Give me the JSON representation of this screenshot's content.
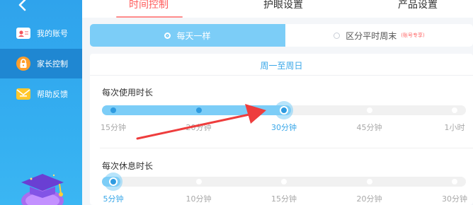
{
  "sidebar": {
    "items": [
      {
        "label": "我的账号",
        "icon": "id-card-icon",
        "active": false
      },
      {
        "label": "家长控制",
        "icon": "lock-icon",
        "active": true
      },
      {
        "label": "帮助反馈",
        "icon": "message-icon",
        "active": false
      }
    ]
  },
  "tabs": [
    {
      "label": "时间控制",
      "active": true
    },
    {
      "label": "护眼设置",
      "active": false
    },
    {
      "label": "产品设置",
      "active": false
    }
  ],
  "mode_toggle": {
    "left": {
      "label": "每天一样",
      "selected": true
    },
    "right": {
      "label": "区分平时周末",
      "note": "(账号专享)",
      "selected": false
    }
  },
  "card": {
    "week_label": "周一至周日",
    "usage": {
      "title": "每次使用时长",
      "ticks": [
        "15分钟",
        "20分钟",
        "30分钟",
        "45分钟",
        "1小时"
      ],
      "selected_index": 2
    },
    "rest": {
      "title": "每次休息时长",
      "ticks": [
        "5分钟",
        "10分钟",
        "15分钟",
        "20分钟",
        "30分钟"
      ],
      "selected_index": 0
    }
  },
  "colors": {
    "accent": "#3aa7e8",
    "active_tab": "#ff5a5a",
    "sidebar": "#2fa3ec",
    "arrow": "#ee3d3d"
  }
}
